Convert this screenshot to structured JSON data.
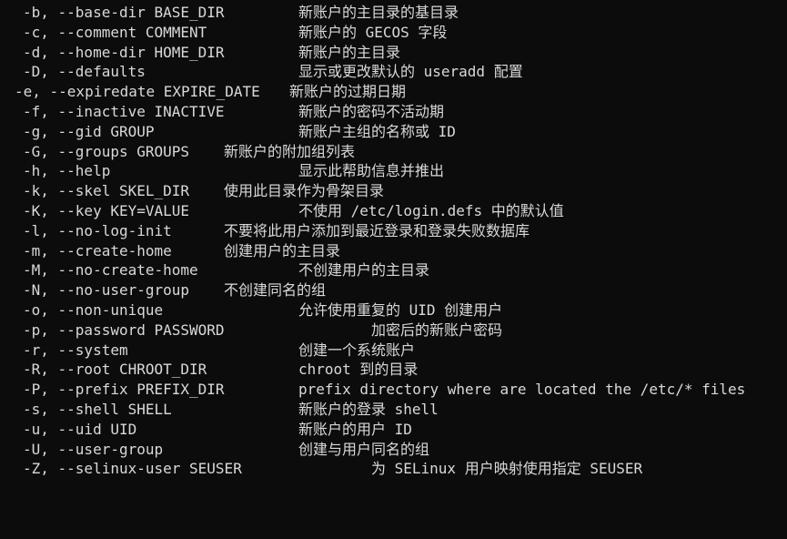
{
  "terminal": {
    "lines": [
      {
        "option": "-b, --base-dir BASE_DIR",
        "desc": "新账户的主目录的基目录"
      },
      {
        "option": "-c, --comment COMMENT",
        "desc": "新账户的 GECOS 字段"
      },
      {
        "option": "-d, --home-dir HOME_DIR",
        "desc": "新账户的主目录"
      },
      {
        "option": "-D, --defaults",
        "desc": "显示或更改默认的 useradd 配置"
      },
      {
        "option": "-e, --expiredate EXPIRE_DATE",
        "desc": "新账户的过期日期"
      },
      {
        "option": "-f, --inactive INACTIVE",
        "desc": "新账户的密码不活动期"
      },
      {
        "option": "-g, --gid GROUP",
        "desc": "新账户主组的名称或 ID"
      },
      {
        "option": "-G, --groups GROUPS",
        "desc": "新账户的附加组列表"
      },
      {
        "option": "-h, --help",
        "desc": "显示此帮助信息并推出"
      },
      {
        "option": "-k, --skel SKEL_DIR",
        "desc": "使用此目录作为骨架目录"
      },
      {
        "option": "-K, --key KEY=VALUE",
        "desc": "不使用 /etc/login.defs 中的默认值"
      },
      {
        "option": "-l, --no-log-init",
        "desc": "不要将此用户添加到最近登录和登录失败数据库"
      },
      {
        "option": "-m, --create-home",
        "desc": "创建用户的主目录"
      },
      {
        "option": "-M, --no-create-home",
        "desc": "不创建用户的主目录"
      },
      {
        "option": "-N, --no-user-group",
        "desc": "不创建同名的组"
      },
      {
        "option": "-o, --non-unique",
        "desc": "允许使用重复的 UID 创建用户"
      },
      {
        "option": "-p, --password PASSWORD",
        "desc": "加密后的新账户密码"
      },
      {
        "option": "-r, --system",
        "desc": "创建一个系统账户"
      },
      {
        "option": "-R, --root CHROOT_DIR",
        "desc": "chroot 到的目录"
      },
      {
        "option": "-P, --prefix PREFIX_DIR",
        "desc": "prefix directory where are located the /etc/* files"
      },
      {
        "option": "-s, --shell SHELL",
        "desc": "新账户的登录 shell"
      },
      {
        "option": "-u, --uid UID",
        "desc": "新账户的用户 ID"
      },
      {
        "option": "-U, --user-group",
        "desc": "创建与用户同名的组"
      },
      {
        "option": "-Z, --selinux-user SEUSER",
        "desc": "为 SELinux 用户映射使用指定 SEUSER"
      }
    ]
  },
  "colors": {
    "background": "#0c0c0c",
    "text": "#d9d9d9"
  }
}
